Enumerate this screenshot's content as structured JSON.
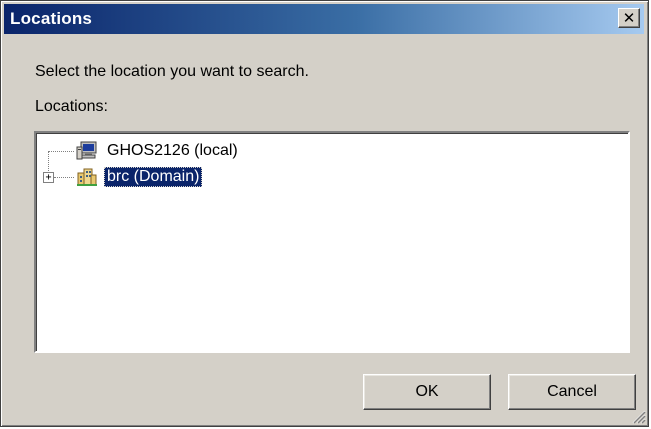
{
  "window": {
    "title": "Locations",
    "close_glyph": "✕"
  },
  "prompt": "Select the location you want to search.",
  "tree": {
    "label": "Locations:",
    "expander_glyph": "+",
    "items": [
      {
        "label": "GHOS2126 (local)",
        "icon": "computer-icon",
        "selected": false
      },
      {
        "label": "brc (Domain)",
        "icon": "domain-icon",
        "selected": true,
        "expandable": true
      }
    ]
  },
  "buttons": {
    "ok": "OK",
    "cancel": "Cancel"
  },
  "colors": {
    "titlebar_start": "#0a246a",
    "titlebar_end": "#a6caf0",
    "face": "#d4d0c8",
    "selection": "#0a246a"
  }
}
